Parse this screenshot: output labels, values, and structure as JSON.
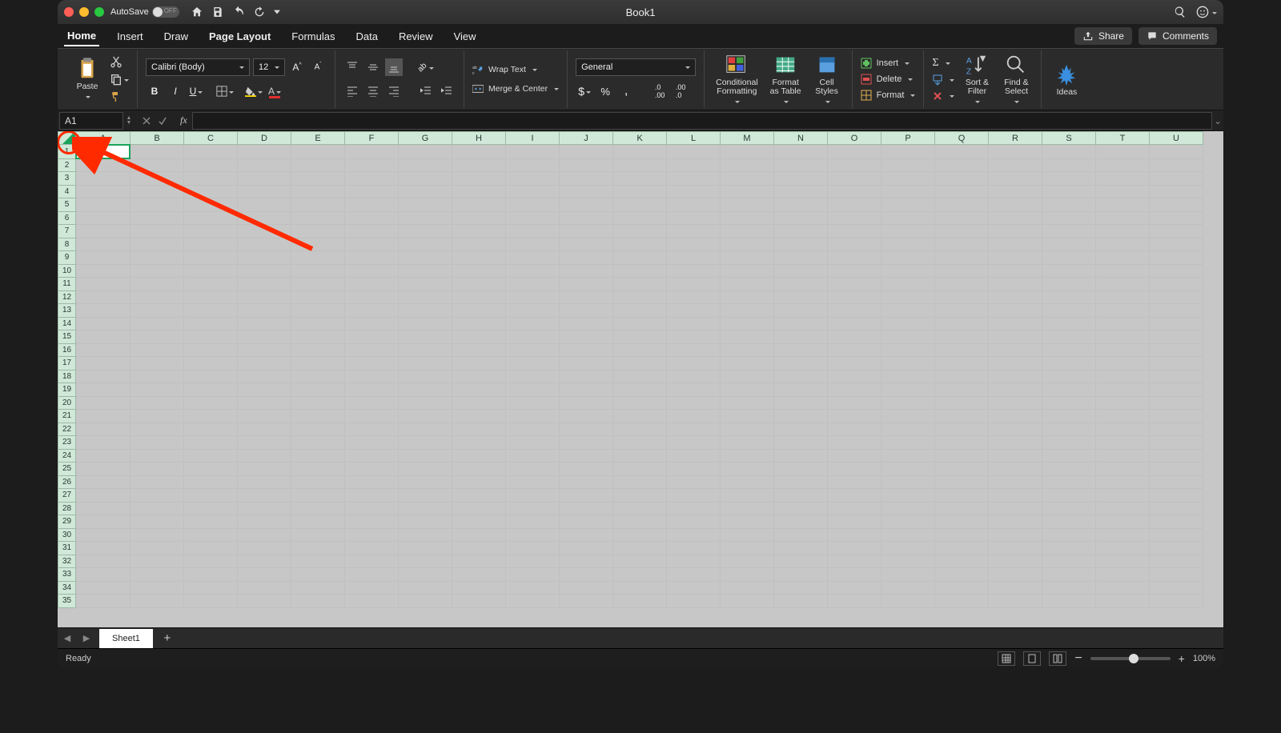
{
  "titlebar": {
    "autosave_label": "AutoSave",
    "autosave_state": "OFF",
    "title": "Book1"
  },
  "tabs": [
    "Home",
    "Insert",
    "Draw",
    "Page Layout",
    "Formulas",
    "Data",
    "Review",
    "View"
  ],
  "tabs_active": 0,
  "share_label": "Share",
  "comments_label": "Comments",
  "font": {
    "name": "Calibri (Body)",
    "size": "12"
  },
  "clipboard": {
    "paste": "Paste"
  },
  "alignment": {
    "wrap": "Wrap Text",
    "merge": "Merge & Center"
  },
  "number": {
    "format": "General"
  },
  "styles": {
    "cond": "Conditional\nFormatting",
    "table": "Format\nas Table",
    "cell": "Cell\nStyles"
  },
  "cells": {
    "insert": "Insert",
    "delete": "Delete",
    "format": "Format"
  },
  "editing": {
    "sort": "Sort &\nFilter",
    "find": "Find &\nSelect"
  },
  "ideas": "Ideas",
  "namebox": "A1",
  "columns": [
    "A",
    "B",
    "C",
    "D",
    "E",
    "F",
    "G",
    "H",
    "I",
    "J",
    "K",
    "L",
    "M",
    "N",
    "O",
    "P",
    "Q",
    "R",
    "S",
    "T",
    "U"
  ],
  "rows": 35,
  "selected": {
    "row": 1,
    "col": "A"
  },
  "sheet_tab": "Sheet1",
  "status_text": "Ready",
  "zoom": "100%"
}
